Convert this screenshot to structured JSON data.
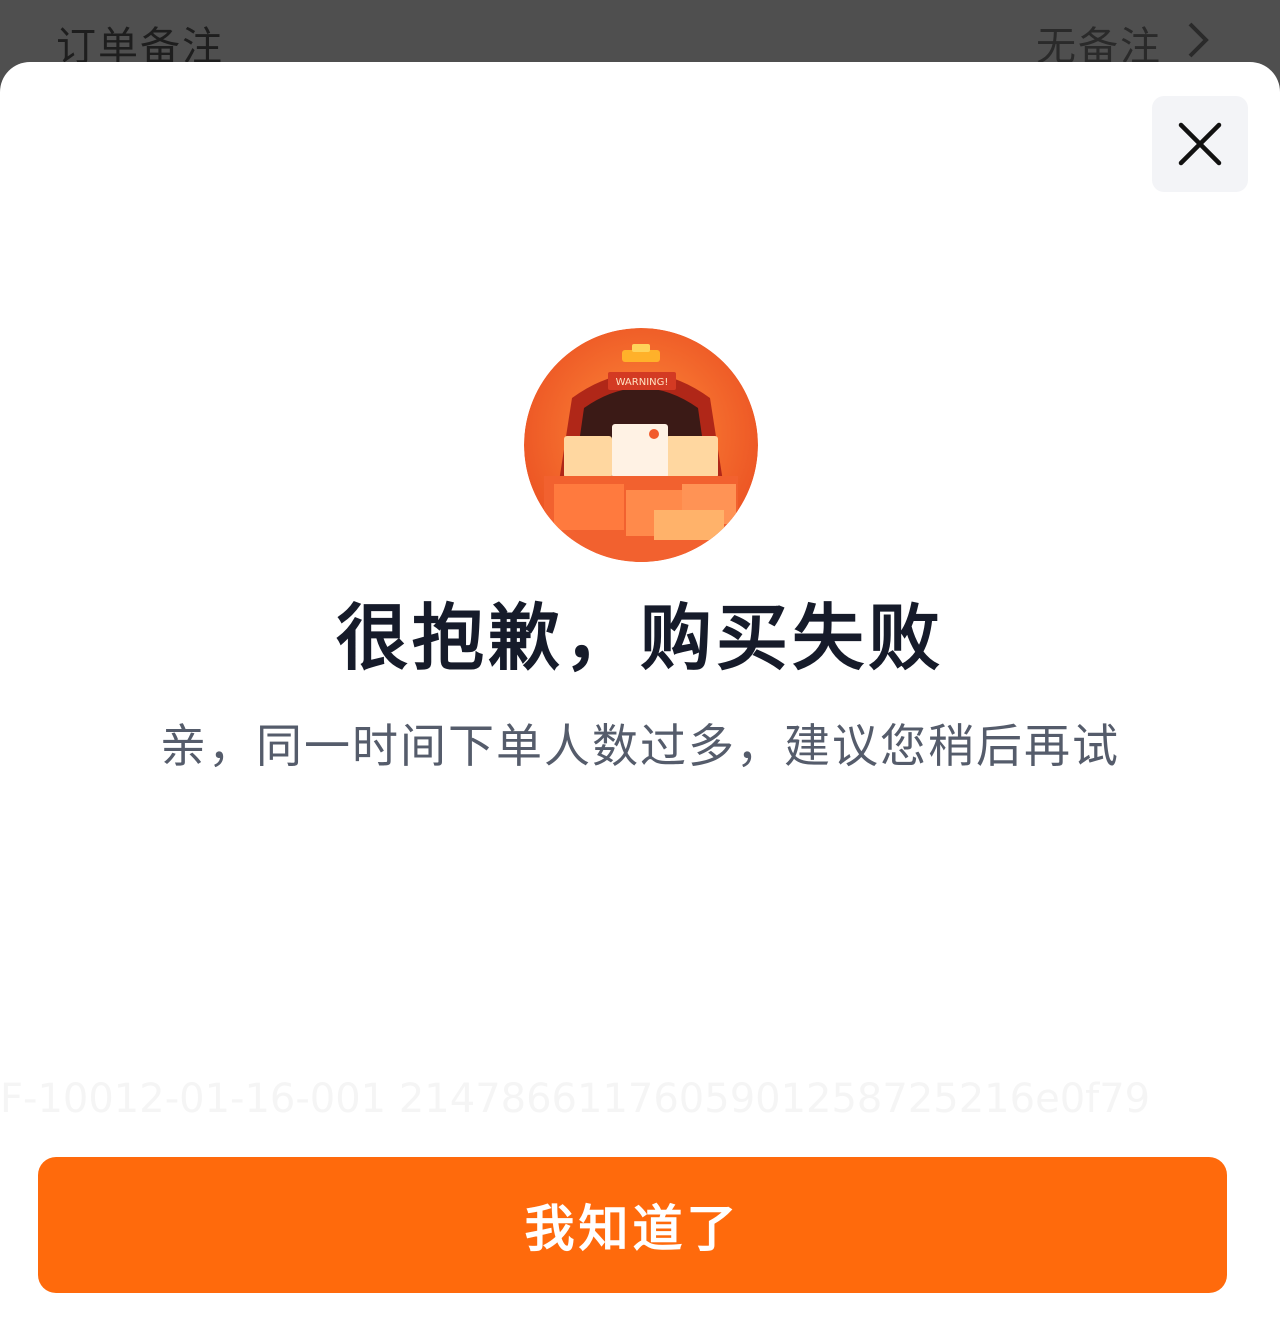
{
  "background_row": {
    "label": "订单备注",
    "value": "无备注",
    "chevron_icon": "chevron-right-icon"
  },
  "dialog": {
    "close_icon": "close-icon",
    "illustration": {
      "icon": "warning-truck-illustration",
      "text": "WARNING!"
    },
    "title": "很抱歉，购买失败",
    "message": "亲，同一时间下单人数过多，建议您稍后再试",
    "trace_id": "F-10012-01-16-001 2147866117605901258725216e0f79",
    "confirm_label": "我知道了"
  },
  "colors": {
    "accent": "#ff6a0c",
    "illustration": "#f0562a",
    "overlay": "#4d4d4d"
  }
}
